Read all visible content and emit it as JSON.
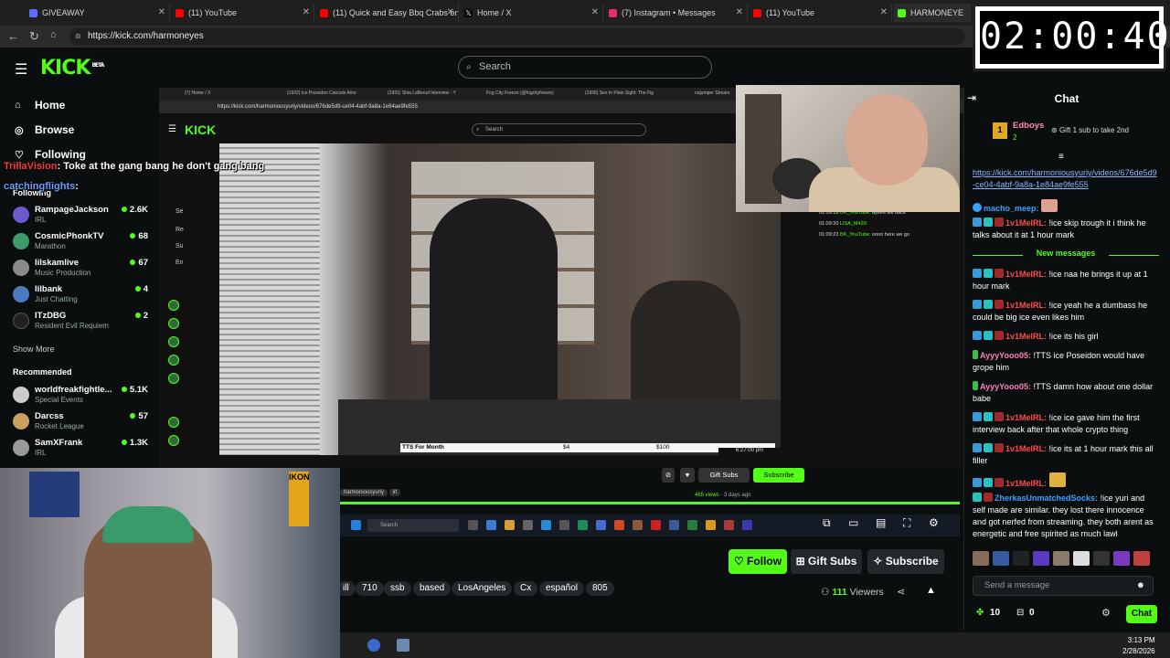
{
  "browser": {
    "tabs": [
      {
        "title": "GIVEAWAY",
        "color": "#5b6cff"
      },
      {
        "title": "(11) YouTube",
        "color": "#ff0000"
      },
      {
        "title": "(11) Quick and Easy Bbq Crabs on",
        "color": "#ff0000"
      },
      {
        "title": "Home / X",
        "color": "#ffffff"
      },
      {
        "title": "(7) Instagram • Messages",
        "color": "#e1306c"
      },
      {
        "title": "(11) YouTube",
        "color": "#ff0000"
      },
      {
        "title": "HARMONEYE",
        "color": "#53fc18"
      }
    ],
    "url": "https://kick.com/harmoneyes"
  },
  "timer": "02:00:40",
  "kick": {
    "logo": "KICK",
    "logo_badge": "BETA",
    "search_placeholder": "Search",
    "nav": [
      {
        "label": "Home",
        "icon": "home-icon"
      },
      {
        "label": "Browse",
        "icon": "compass-icon"
      },
      {
        "label": "Following",
        "icon": "heart-icon"
      }
    ],
    "following_header": "Following",
    "following": [
      {
        "name": "RampageJackson",
        "category": "IRL",
        "viewers": "2.6K",
        "color": "#6a5acd"
      },
      {
        "name": "CosmicPhonkTV",
        "category": "Marathon",
        "viewers": "68",
        "color": "#3c9a6a"
      },
      {
        "name": "lilskamlive",
        "category": "Music Production",
        "viewers": "67",
        "color": "#8a8a8a"
      },
      {
        "name": "lilbank",
        "category": "Just Chatting",
        "viewers": "4",
        "color": "#4a7ac0"
      },
      {
        "name": "ITzDBG",
        "category": "Resident Evil Requiem",
        "viewers": "2",
        "color": "#222222"
      }
    ],
    "show_more": "Show More",
    "recommended_header": "Recommended",
    "recommended": [
      {
        "name": "worldfreakfightle...",
        "category": "Special Events",
        "viewers": "5.1K",
        "color": "#cccccc"
      },
      {
        "name": "Darcss",
        "category": "Rocket League",
        "viewers": "57",
        "color": "#c8a060"
      },
      {
        "name": "SamXFrank",
        "category": "IRL",
        "viewers": "1.3K",
        "color": "#999999"
      }
    ],
    "overlay": {
      "user1": "TrillaVision",
      "msg1": ": Toke at the gang bang he don't gang bang",
      "user2": "catchingflights",
      "msg2": ":"
    },
    "actions": {
      "follow": "Follow",
      "gift_subs": "Gift Subs",
      "subscribe": "Subscribe"
    },
    "tags": [
      "ill",
      "710",
      "ssb",
      "based",
      "LosAngeles",
      "Cx",
      "español",
      "805"
    ],
    "viewers_count": "111",
    "viewers_label": "Viewers"
  },
  "embed": {
    "tabs": [
      "(7) Home / X",
      "(1932) Ice Poseidon Cancels Amo",
      "(1931) Shia LaBeouf Interview - Y",
      "Fog City Freeze (@fogcityfreeze)",
      "(1936) Sex In Plain Sight: The Fig",
      "nojumper Stream"
    ],
    "url": "https://kick.com/harmoniousyuriy/videos/676de5d9-ce04-4abf-9a8a-1e84ae9fe555",
    "logo": "KICK",
    "search": "Search",
    "side_letters": [
      "Se",
      "Re",
      "Su",
      "En"
    ],
    "donation": {
      "label": "TTS For Month",
      "amount": "$4",
      "goal": "$100"
    },
    "video_time": "6:27:00 pm",
    "stream_tag": "harmoniousyuriy",
    "stream_tag2": "irl",
    "views": "465 views",
    "ago": "3 days ago",
    "gift_subs": "Gift Subs",
    "subscribe": "Subscribe",
    "search2": "Search",
    "chat": [
      {
        "time": "01:09:18",
        "user": "BK_YouTube:",
        "text": "ayeee we back"
      },
      {
        "time": "01:09:20",
        "user": "LISA_M420:",
        "text": ""
      },
      {
        "time": "01:09:23",
        "user": "BK_YouTube:",
        "text": "oooo here we go"
      }
    ]
  },
  "os": {
    "time": "3:13 PM",
    "date": "2/28/2026"
  },
  "chat": {
    "title": "Chat",
    "gifter": {
      "rank": "1",
      "name": "Edboys",
      "count": "2",
      "cta": "Gift 1 sub to take 2nd"
    },
    "link": "https://kick.com/harmoniousyuriy/videos/676de5d9-ce04-4abf-9a8a-1e84ae9fe555",
    "messages": [
      {
        "user": "macho_meep:",
        "text": "",
        "color": "#3aa0ff"
      },
      {
        "user": "1v1MeIRL:",
        "text": "!ice skip trough it i think he talks about it at 1 hour mark",
        "color": "#ff4a4a"
      }
    ],
    "new_messages": "New messages",
    "messages2": [
      {
        "user": "1v1MeIRL:",
        "text": "!ice naa he brings it up at 1 hour mark",
        "color": "#ff4a4a"
      },
      {
        "user": "1v1MeIRL:",
        "text": "!ice yeah he a dumbass he could be big ice even likes him",
        "color": "#ff4a4a"
      },
      {
        "user": "1v1MeIRL:",
        "text": "!ice its his girl",
        "color": "#ff4a4a"
      },
      {
        "user": "AyyyYooo05:",
        "text": "!TTS ice Poseidon would have grope him",
        "color": "#ff7eb6"
      },
      {
        "user": "AyyyYooo05:",
        "text": "!TTS damn how about one dollar babe",
        "color": "#ff7eb6"
      },
      {
        "user": "1v1MeIRL:",
        "text": "!ice ice gave him the first interview back after that whole crypto thing",
        "color": "#ff4a4a"
      },
      {
        "user": "1v1MeIRL:",
        "text": "!ice its at 1 hour mark this all filler",
        "color": "#ff4a4a"
      },
      {
        "user": "1v1MeIRL:",
        "text": "",
        "color": "#ff4a4a"
      },
      {
        "user": "ZherkasUnmatchedSocks:",
        "text": "!ice yuri and self made are similar. they lost there innocence and got nerfed from streaming. they both arent as energetic and free spirited as much lawl",
        "color": "#3aa0ff"
      }
    ],
    "send_placeholder": "Send a message",
    "points": "10",
    "other": "0",
    "chat_button": "Chat"
  }
}
